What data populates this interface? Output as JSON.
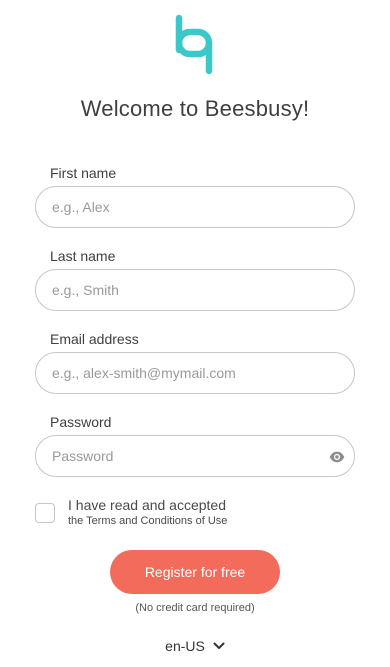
{
  "brand": {
    "logo_icon": "beesbusy-logo-icon",
    "accent_color": "#3cc8c8"
  },
  "page": {
    "title": "Welcome to Beesbusy!"
  },
  "form": {
    "first_name": {
      "label": "First name",
      "placeholder": "e.g., Alex",
      "value": ""
    },
    "last_name": {
      "label": "Last name",
      "placeholder": "e.g., Smith",
      "value": ""
    },
    "email": {
      "label": "Email address",
      "placeholder": "e.g., alex-smith@mymail.com",
      "value": ""
    },
    "password": {
      "label": "Password",
      "placeholder": "Password",
      "value": "",
      "toggle_icon": "eye-icon"
    },
    "terms": {
      "checked": false,
      "line1": "I have read and accepted",
      "line2": "the Terms and Conditions of Use"
    },
    "submit": {
      "label": "Register for free",
      "color": "#f26b5b"
    },
    "note": "(No credit card required)"
  },
  "language": {
    "selected": "en-US",
    "icon": "chevron-down-icon"
  }
}
